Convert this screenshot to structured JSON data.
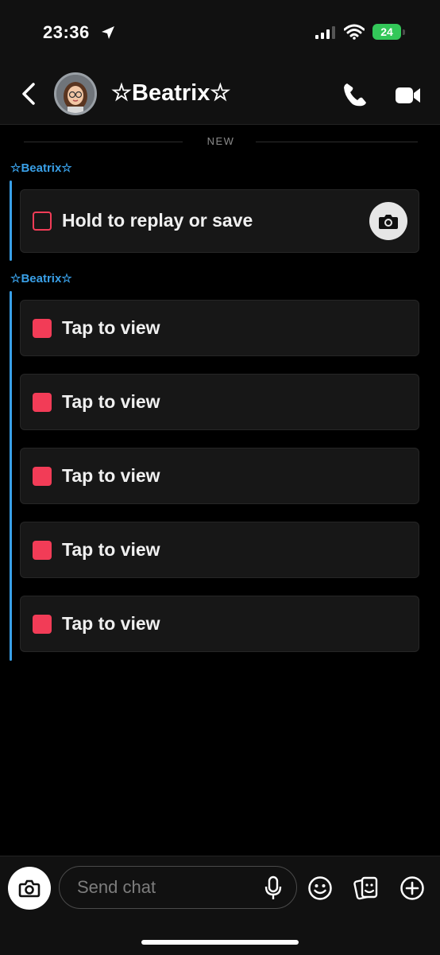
{
  "status_bar": {
    "time": "23:36",
    "battery_level": "24",
    "battery_color": "#33c759"
  },
  "header": {
    "contact_name": "☆Beatrix☆",
    "icons": [
      "back-icon",
      "phone-icon",
      "video-call-icon"
    ]
  },
  "divider": {
    "label": "NEW"
  },
  "threads": [
    {
      "sender": "☆Beatrix☆",
      "snaps": [
        {
          "text": "Hold to replay or save",
          "opened": true
        }
      ]
    },
    {
      "sender": "☆Beatrix☆",
      "snaps": [
        {
          "text": "Tap to view",
          "opened": false
        },
        {
          "text": "Tap to view",
          "opened": false
        },
        {
          "text": "Tap to view",
          "opened": false
        },
        {
          "text": "Tap to view",
          "opened": false
        },
        {
          "text": "Tap to view",
          "opened": false
        }
      ]
    }
  ],
  "composer": {
    "placeholder": "Send chat",
    "icons": [
      "camera-icon",
      "microphone-icon",
      "emoji-icon",
      "sticker-icon",
      "plus-icon"
    ]
  },
  "colors": {
    "snap_red": "#f23c57",
    "sender_blue": "#39a0e8",
    "background": "#000000"
  }
}
